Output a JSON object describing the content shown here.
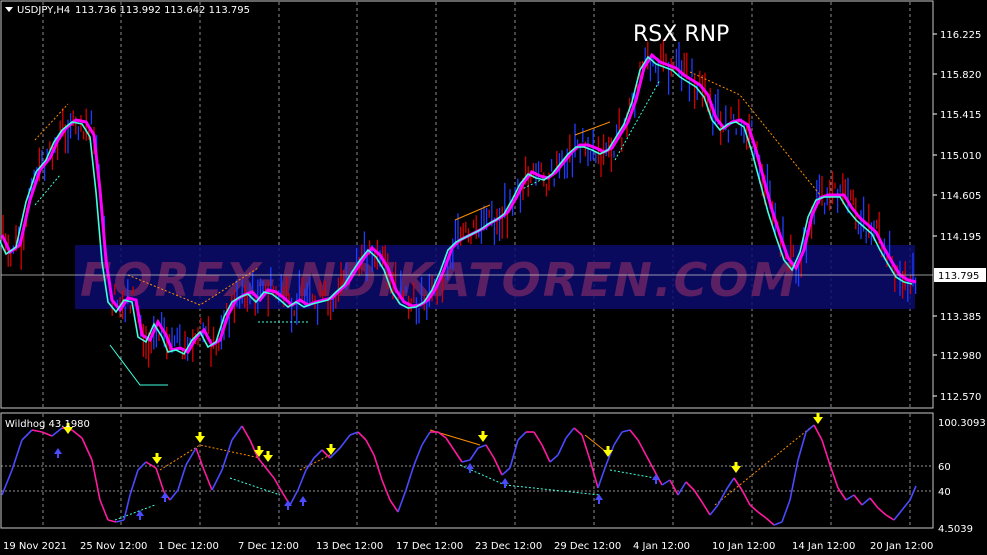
{
  "header": {
    "symbol": "USDJPY,H4",
    "ohlc": "113.736 113.992 113.642 113.795",
    "menu_icon": "triangle-down-icon"
  },
  "overlay_title": "RSX RNP",
  "watermark": "FOREX-INDIKATOREN.COM",
  "price_axis": {
    "ticks": [
      "116.225",
      "115.820",
      "115.415",
      "115.010",
      "114.605",
      "114.195",
      "113.385",
      "112.980",
      "112.570"
    ],
    "current_price": "113.795"
  },
  "indicator": {
    "title": "Wildhog 43.1980",
    "ticks": [
      "100.3093",
      "60",
      "40",
      "4.5039"
    ]
  },
  "time_axis": {
    "labels": [
      "19 Nov 2021",
      "25 Nov 12:00",
      "1 Dec 12:00",
      "7 Dec 12:00",
      "13 Dec 12:00",
      "17 Dec 12:00",
      "23 Dec 12:00",
      "29 Dec 12:00",
      "4 Jan 12:00",
      "10 Jan 12:00",
      "14 Jan 12:00",
      "20 Jan 12:00"
    ]
  },
  "colors": {
    "background": "#000000",
    "grid": "#c8c8c8",
    "bull_candle": "#1e3cff",
    "bear_candle": "#d40000",
    "line_magenta": "#ff00ff",
    "line_aqua": "#40ffe0",
    "indicator_up": "#4a4aff",
    "indicator_down": "#ff1aa0",
    "arrow_up": "#4a4aff",
    "arrow_down": "#ffff00"
  },
  "chart_data": {
    "type": "line",
    "title": "",
    "xlabel": "",
    "ylabel": "",
    "x": [
      "19 Nov 2021",
      "25 Nov 12:00",
      "1 Dec 12:00",
      "7 Dec 12:00",
      "13 Dec 12:00",
      "17 Dec 12:00",
      "23 Dec 12:00",
      "29 Dec 12:00",
      "4 Jan 12:00",
      "10 Jan 12:00",
      "14 Jan 12:00",
      "20 Jan 12:00"
    ],
    "ylim": [
      112.45,
      116.45
    ],
    "series": [
      {
        "values": [
          114.05,
          112.98,
          113.1,
          113.5,
          113.45,
          113.75,
          114.55,
          115.1,
          116.05,
          115.3,
          114.6,
          113.75
        ]
      },
      {
        "values": [
          114.1,
          113.05,
          113.05,
          113.45,
          113.5,
          113.7,
          114.45,
          115.05,
          115.95,
          115.4,
          114.65,
          113.8
        ]
      }
    ],
    "indicator": {
      "ylim": [
        4.5039,
        100.3093
      ],
      "values": [
        60,
        12,
        65,
        72,
        40,
        45,
        38,
        70,
        72,
        60,
        90,
        10,
        25
      ]
    }
  }
}
